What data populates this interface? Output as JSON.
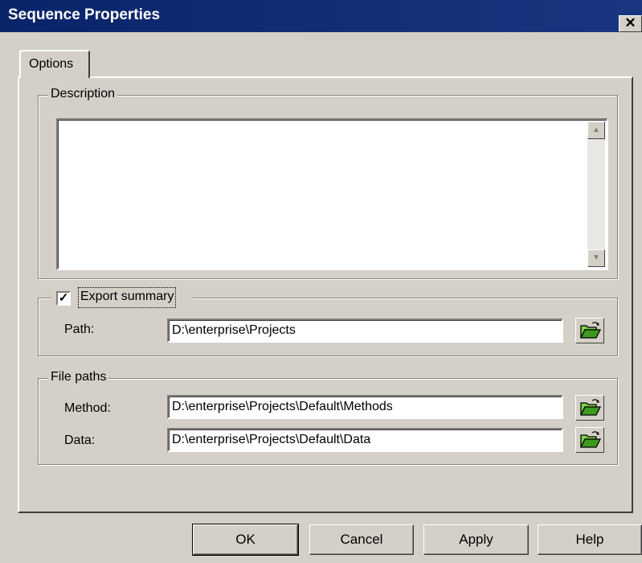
{
  "window": {
    "title": "Sequence Properties",
    "close_glyph": "✕"
  },
  "tabs": [
    {
      "label": "Options"
    }
  ],
  "description": {
    "legend": "Description",
    "value": ""
  },
  "export_summary": {
    "label": "Export summary",
    "checked": true,
    "check_glyph": "✓",
    "path_label": "Path:",
    "path_value": "D:\\enterprise\\Projects"
  },
  "file_paths": {
    "legend": "File paths",
    "method_label": "Method:",
    "method_value": "D:\\enterprise\\Projects\\Default\\Methods",
    "data_label": "Data:",
    "data_value": "D:\\enterprise\\Projects\\Default\\Data"
  },
  "buttons": {
    "ok": "OK",
    "cancel": "Cancel",
    "apply": "Apply",
    "help": "Help"
  },
  "icons": {
    "browse": "folder-open-icon",
    "scroll_up": "arrow-up-icon",
    "scroll_down": "arrow-down-icon"
  },
  "colors": {
    "titlebar": "#0a246a",
    "face": "#d4d0c8",
    "folder": "#3c9a1c"
  }
}
